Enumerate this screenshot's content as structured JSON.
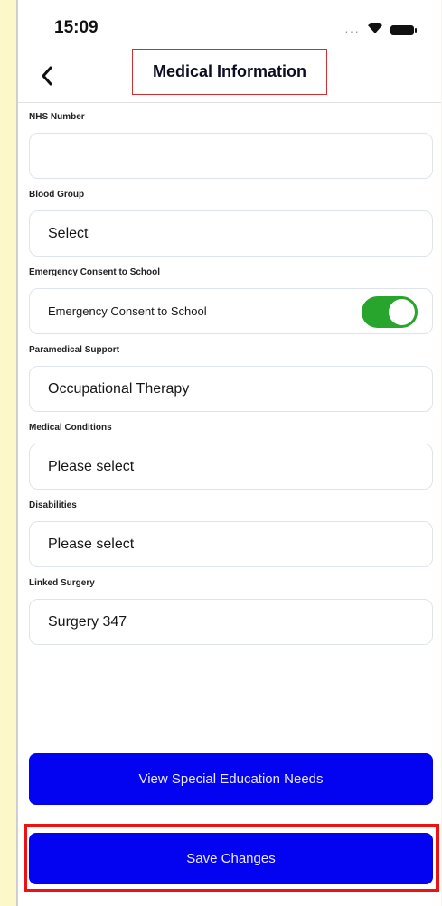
{
  "status_bar": {
    "time": "15:09",
    "signal": "···"
  },
  "header": {
    "title": "Medical Information"
  },
  "fields": {
    "nhs_number": {
      "label": "NHS Number",
      "value": ""
    },
    "blood_group": {
      "label": "Blood Group",
      "value": "Select"
    },
    "emergency_consent": {
      "label": "Emergency Consent to School",
      "value": "Emergency Consent to School",
      "toggle_on": true
    },
    "paramedical_support": {
      "label": "Paramedical Support",
      "value": "Occupational Therapy"
    },
    "medical_conditions": {
      "label": "Medical Conditions",
      "value": "Please select"
    },
    "disabilities": {
      "label": "Disabilities",
      "value": "Please select"
    },
    "linked_surgery": {
      "label": "Linked Surgery",
      "value": "Surgery 347"
    }
  },
  "buttons": {
    "view_sen": "View Special Education Needs",
    "save": "Save Changes"
  },
  "colors": {
    "primary_button": "#0303f2",
    "toggle_on": "#27a52d",
    "highlight": "#ee1111",
    "page_background": "#fcf8c9"
  }
}
